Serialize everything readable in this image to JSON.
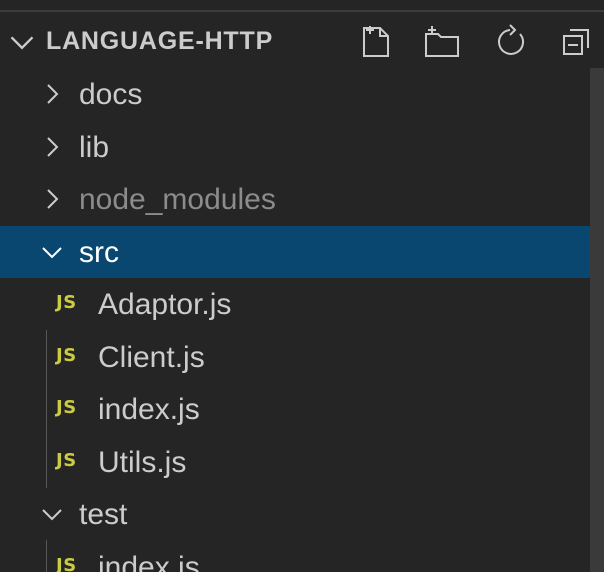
{
  "explorer": {
    "title": "LANGUAGE-HTTP",
    "actions": [
      {
        "name": "new-file-icon"
      },
      {
        "name": "new-folder-icon"
      },
      {
        "name": "refresh-icon"
      },
      {
        "name": "collapse-all-icon"
      }
    ]
  },
  "tree": {
    "items": [
      {
        "label": "docs",
        "type": "folder",
        "expanded": false
      },
      {
        "label": "lib",
        "type": "folder",
        "expanded": false
      },
      {
        "label": "node_modules",
        "type": "folder",
        "expanded": false,
        "dimmed": true
      },
      {
        "label": "src",
        "type": "folder",
        "expanded": true,
        "selected": true
      },
      {
        "label": "Adaptor.js",
        "type": "file",
        "icon": "JS"
      },
      {
        "label": "Client.js",
        "type": "file",
        "icon": "JS"
      },
      {
        "label": "index.js",
        "type": "file",
        "icon": "JS"
      },
      {
        "label": "Utils.js",
        "type": "file",
        "icon": "JS"
      },
      {
        "label": "test",
        "type": "folder",
        "expanded": true
      },
      {
        "label": "index.js",
        "type": "file",
        "icon": "JS"
      }
    ]
  },
  "colors": {
    "background": "#252526",
    "selection": "#094771",
    "js_icon": "#cbcb41",
    "text": "#cccccc"
  }
}
